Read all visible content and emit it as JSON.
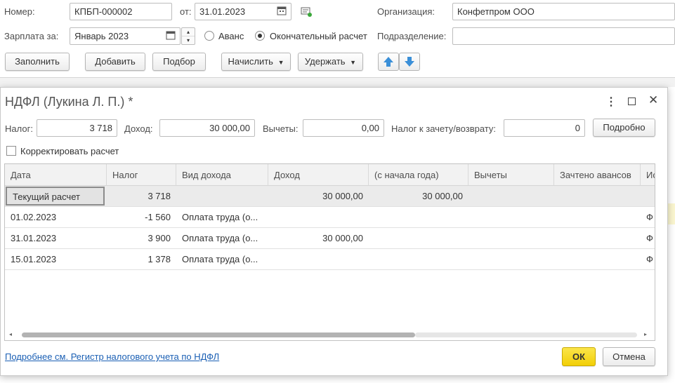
{
  "doc": {
    "number_label": "Номер:",
    "number_value": "КПБП-000002",
    "date_label": "от:",
    "date_value": "31.01.2023",
    "org_label": "Организация:",
    "org_value": "Конфетпром ООО",
    "salary_label": "Зарплата за:",
    "salary_value": "Январь 2023",
    "radio_advance": "Аванс",
    "radio_final": "Окончательный расчет",
    "subdivision_label": "Подразделение:",
    "subdivision_value": ""
  },
  "toolbar": {
    "fill": "Заполнить",
    "add": "Добавить",
    "pick": "Подбор",
    "accrue": "Начислить",
    "withhold": "Удержать"
  },
  "dialog": {
    "title": "НДФЛ (Лукина Л. П.) *",
    "tax_label": "Налог:",
    "tax_value": "3 718",
    "income_label": "Доход:",
    "income_value": "30 000,00",
    "deductions_label": "Вычеты:",
    "deductions_value": "0,00",
    "offset_label": "Налог к зачету/возврату:",
    "offset_value": "0",
    "details_button": "Подробно",
    "correct_label": "Корректировать расчет",
    "link": "Подробнее см. Регистр налогового учета по НДФЛ",
    "ok": "ОК",
    "cancel": "Отмена"
  },
  "table": {
    "columns": [
      "Дата",
      "Налог",
      "Вид дохода",
      "Доход",
      "(с начала года)",
      "Вычеты",
      "Зачтено авансов",
      "Ис"
    ],
    "rows": [
      {
        "date": "Текущий расчет",
        "tax": "3 718",
        "kind": "",
        "income": "30 000,00",
        "ytd": "30 000,00",
        "deduct": "",
        "adv": "",
        "src": ""
      },
      {
        "date": "01.02.2023",
        "tax": "-1 560",
        "kind": "Оплата труда (о...",
        "income": "",
        "ytd": "",
        "deduct": "",
        "adv": "",
        "src": "Ф"
      },
      {
        "date": "31.01.2023",
        "tax": "3 900",
        "kind": "Оплата труда (о...",
        "income": "30 000,00",
        "ytd": "",
        "deduct": "",
        "adv": "",
        "src": "Ф"
      },
      {
        "date": "15.01.2023",
        "tax": "1 378",
        "kind": "Оплата труда (о...",
        "income": "",
        "ytd": "",
        "deduct": "",
        "adv": "",
        "src": "Ф"
      }
    ]
  },
  "colors": {
    "accent_ok": "#f5d80f",
    "link": "#1a5fb4",
    "arrow": "#3a8fd8"
  }
}
